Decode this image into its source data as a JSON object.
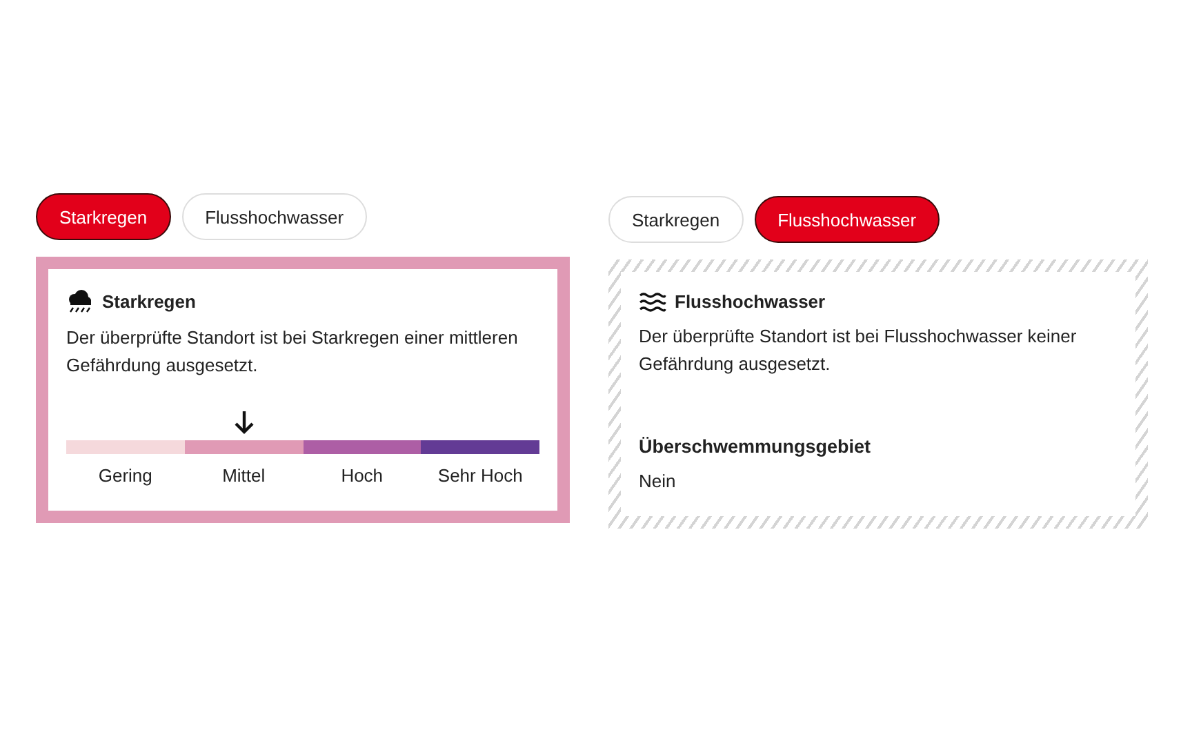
{
  "panels": [
    {
      "kind": "scale",
      "tabs": [
        {
          "label": "Starkregen",
          "selected": true
        },
        {
          "label": "Flusshochwasser",
          "selected": false
        }
      ],
      "title": "Starkregen",
      "text": "Der überprüfte Standort ist bei Starkregen einer mittleren Gefährdung ausgesetzt.",
      "levels": [
        {
          "label": "Gering",
          "color": "#f5d9dc",
          "selected": false
        },
        {
          "label": "Mittel",
          "color": "#e09ab5",
          "selected": true
        },
        {
          "label": "Hoch",
          "color": "#ad5ea5",
          "selected": false
        },
        {
          "label": "Sehr Hoch",
          "color": "#633b95",
          "selected": false
        }
      ]
    },
    {
      "kind": "info",
      "tabs": [
        {
          "label": "Starkregen",
          "selected": false
        },
        {
          "label": "Flusshochwasser",
          "selected": true
        }
      ],
      "title": "Flusshochwasser",
      "text": "Der überprüfte Standort ist bei Flusshochwasser keiner Gefährdung ausgesetzt.",
      "detail": {
        "heading": "Überschwemmungsgebiet",
        "value": "Nein"
      }
    }
  ]
}
